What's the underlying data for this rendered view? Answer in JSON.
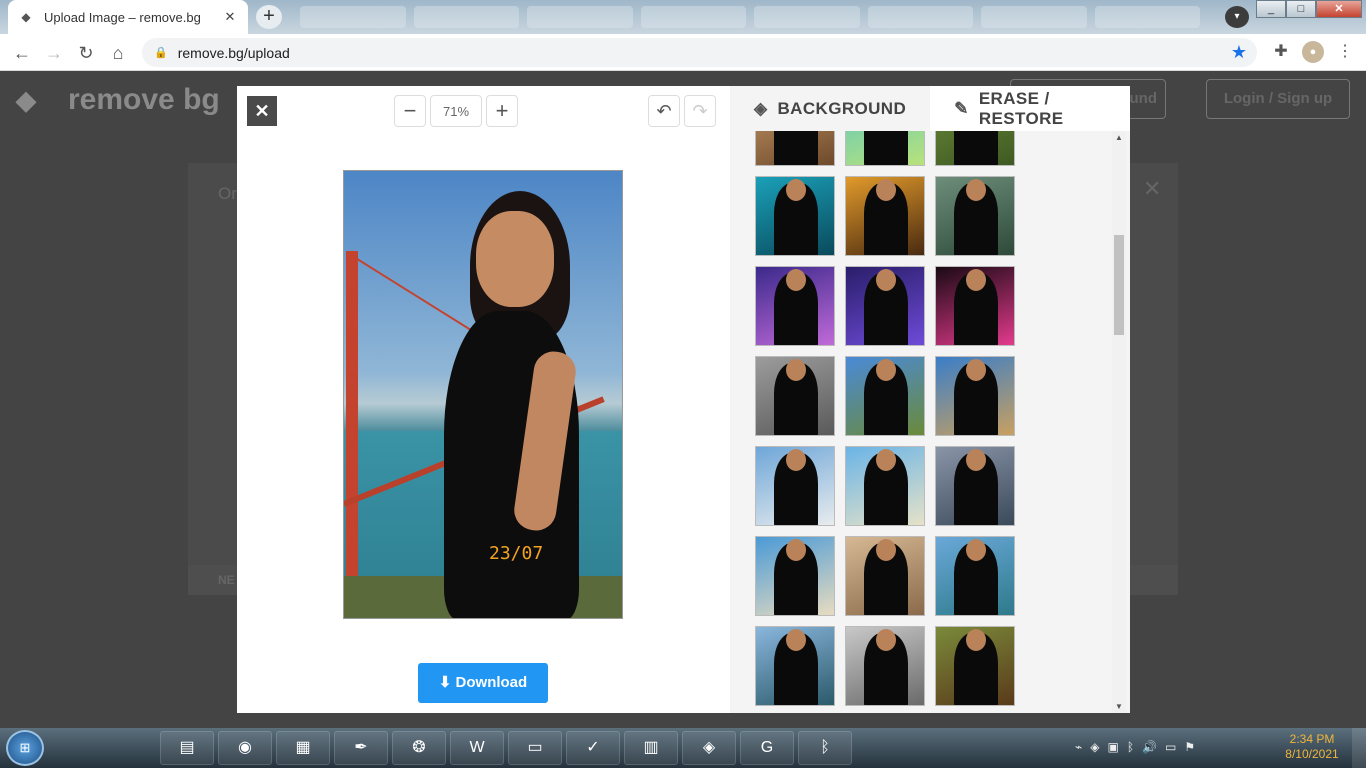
{
  "browser": {
    "tab_title": "Upload Image – remove.bg",
    "url": "remove.bg/upload"
  },
  "background_page": {
    "logo_text": "remove bg",
    "upload_button_fragment": "round",
    "login_label": "Login / Sign up",
    "card_text_fragment": "Or",
    "card_footer_fragment": "NE"
  },
  "editor": {
    "zoom_value": "71%",
    "photo_stamp": "23/07",
    "download_label": "Download"
  },
  "panel": {
    "tabs": [
      {
        "label": "BACKGROUND",
        "icon": "layers-icon",
        "active": true
      },
      {
        "label": "ERASE / RESTORE",
        "icon": "brush-icon",
        "active": false
      }
    ],
    "thumbnails": [
      {
        "bg": "#c89a6a",
        "bg2": "#6e4a2b",
        "name": "thumb-1"
      },
      {
        "bg": "#58c6c6",
        "bg2": "#b8e27a",
        "name": "thumb-2"
      },
      {
        "bg": "#6d8c3b",
        "bg2": "#3f5a22",
        "name": "thumb-3"
      },
      {
        "bg": "#1aa0b8",
        "bg2": "#0a4a5c",
        "name": "thumb-4"
      },
      {
        "bg": "#e19a2b",
        "bg2": "#4a2a10",
        "name": "thumb-5"
      },
      {
        "bg": "#6d8e7a",
        "bg2": "#2e4a3a",
        "name": "thumb-6"
      },
      {
        "bg": "#3c2a8c",
        "bg2": "#c06ad8",
        "name": "thumb-7"
      },
      {
        "bg": "#2a1e6a",
        "bg2": "#6e4bd8",
        "name": "thumb-8"
      },
      {
        "bg": "#1a0a14",
        "bg2": "#e33a8c",
        "name": "thumb-9"
      },
      {
        "bg": "#9c9c9c",
        "bg2": "#5a5a5a",
        "name": "thumb-10"
      },
      {
        "bg": "#4a8ad8",
        "bg2": "#6a8a3a",
        "name": "thumb-11"
      },
      {
        "bg": "#3a7ec8",
        "bg2": "#c8a060",
        "name": "thumb-12"
      },
      {
        "bg": "#6ea6d8",
        "bg2": "#e8ecee",
        "name": "thumb-13"
      },
      {
        "bg": "#6ab4e6",
        "bg2": "#e6e2c8",
        "name": "thumb-14"
      },
      {
        "bg": "#8a94a8",
        "bg2": "#3a4a5a",
        "name": "thumb-15"
      },
      {
        "bg": "#4a9ad6",
        "bg2": "#e8dcc0",
        "name": "thumb-16"
      },
      {
        "bg": "#d6b894",
        "bg2": "#8a6a4a",
        "name": "thumb-17"
      },
      {
        "bg": "#6aa8d8",
        "bg2": "#2e7a8b",
        "name": "thumb-18"
      },
      {
        "bg": "#8ab6dc",
        "bg2": "#2a5a6a",
        "name": "thumb-19"
      },
      {
        "bg": "#c8c8c8",
        "bg2": "#6a6a6a",
        "name": "thumb-20"
      },
      {
        "bg": "#7a8a3a",
        "bg2": "#5a3a1a",
        "name": "thumb-21"
      }
    ]
  },
  "taskbar": {
    "items": [
      "notepad",
      "chrome",
      "photo-app",
      "feather-app",
      "emblem-app",
      "word",
      "explorer",
      "sticky-notes",
      "calculator",
      "dropbox",
      "grammarly",
      "bluetooth"
    ],
    "clock_time": "2:34 PM",
    "clock_date": "8/10/2021"
  },
  "colors": {
    "accent": "#2196f3",
    "modal_bg": "#ffffff",
    "panel_bg": "#f4f4f4",
    "overlay": "#444444"
  }
}
